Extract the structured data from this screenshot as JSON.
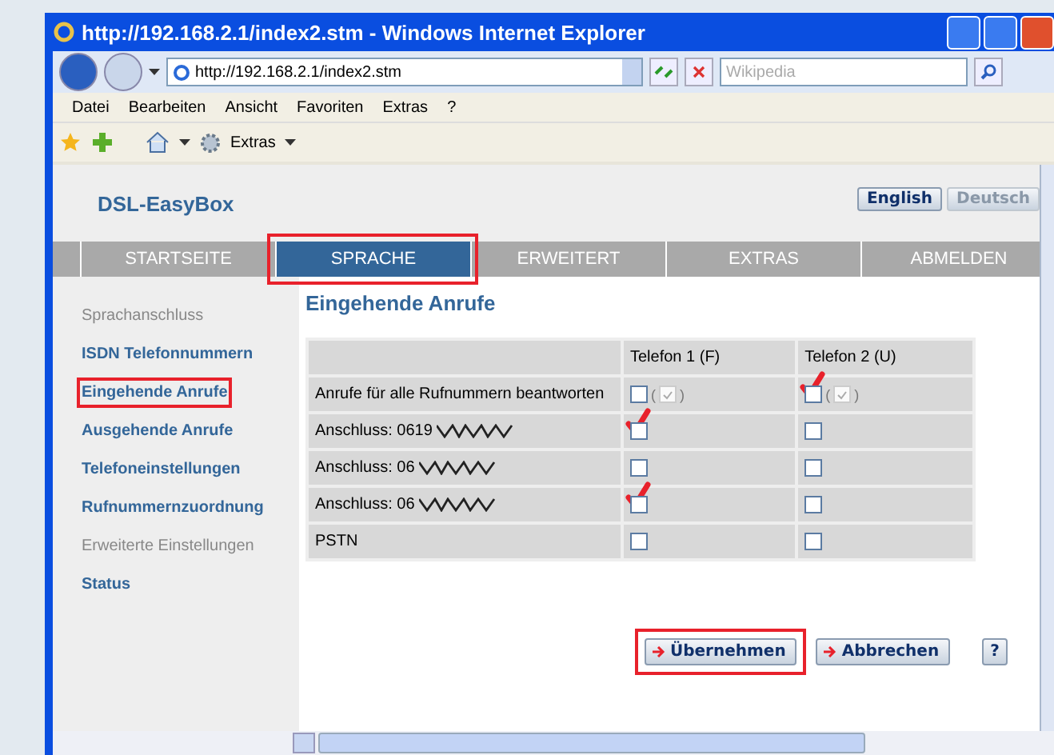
{
  "window": {
    "title": "http://192.168.2.1/index2.stm - Windows Internet Explorer"
  },
  "address_bar": {
    "url": "http://192.168.2.1/index2.stm"
  },
  "search": {
    "placeholder": "Wikipedia"
  },
  "menu": [
    "Datei",
    "Bearbeiten",
    "Ansicht",
    "Favoriten",
    "Extras",
    "?"
  ],
  "toolbar": {
    "tools_label": "Extras"
  },
  "page": {
    "logo": "DSL-EasyBox",
    "languages": [
      {
        "label": "English",
        "disabled": false
      },
      {
        "label": "Deutsch",
        "disabled": true
      }
    ],
    "tabs": [
      {
        "label": "STARTSEITE",
        "selected": false,
        "highlighted": false
      },
      {
        "label": "SPRACHE",
        "selected": true,
        "highlighted": true
      },
      {
        "label": "ERWEITERT",
        "selected": false,
        "highlighted": false
      },
      {
        "label": "EXTRAS",
        "selected": false,
        "highlighted": false
      },
      {
        "label": "ABMELDEN",
        "selected": false,
        "highlighted": false
      }
    ],
    "sidebar": {
      "items": [
        {
          "label": "Sprachanschluss",
          "disabled": true,
          "highlighted": false
        },
        {
          "label": "ISDN Telefonnummern",
          "disabled": false,
          "highlighted": false
        },
        {
          "label": "Eingehende Anrufe",
          "disabled": false,
          "highlighted": true
        },
        {
          "label": "Ausgehende Anrufe",
          "disabled": false,
          "highlighted": false
        },
        {
          "label": "Telefoneinstellungen",
          "disabled": false,
          "highlighted": false
        },
        {
          "label": "Rufnummernzuordnung",
          "disabled": false,
          "highlighted": false
        },
        {
          "label": "Erweiterte Einstellungen",
          "disabled": true,
          "highlighted": false
        },
        {
          "label": "Status",
          "disabled": false,
          "highlighted": false
        }
      ]
    },
    "heading": "Eingehende Anrufe",
    "table": {
      "columns": [
        "Telefon 1 (F)",
        "Telefon 2 (U)"
      ],
      "rows": [
        {
          "label": "Anrufe für alle Rufnummern beantworten",
          "masked": false,
          "cells": [
            {
              "checked": false,
              "annotated": false,
              "all_checked": true,
              "bracket_open": "(",
              "bracket_close": ")"
            },
            {
              "checked": false,
              "annotated": true,
              "all_checked": true,
              "bracket_open": "(",
              "bracket_close": ")"
            }
          ]
        },
        {
          "label": "Anschluss: 0619",
          "masked": true,
          "cells": [
            {
              "checked": false,
              "annotated": true
            },
            {
              "checked": false,
              "annotated": false
            }
          ]
        },
        {
          "label": "Anschluss: 06",
          "masked": true,
          "cells": [
            {
              "checked": false,
              "annotated": false
            },
            {
              "checked": false,
              "annotated": false
            }
          ]
        },
        {
          "label": "Anschluss: 06",
          "masked": true,
          "cells": [
            {
              "checked": false,
              "annotated": true
            },
            {
              "checked": false,
              "annotated": false
            }
          ]
        },
        {
          "label": "PSTN",
          "masked": false,
          "cells": [
            {
              "checked": false,
              "annotated": false
            },
            {
              "checked": false,
              "annotated": false
            }
          ]
        }
      ]
    },
    "buttons": [
      {
        "label": "Übernehmen",
        "kind": "arrow",
        "highlighted": true
      },
      {
        "label": "Abbrechen",
        "kind": "arrow",
        "highlighted": false
      },
      {
        "label": "?",
        "kind": "help",
        "highlighted": false
      }
    ]
  }
}
